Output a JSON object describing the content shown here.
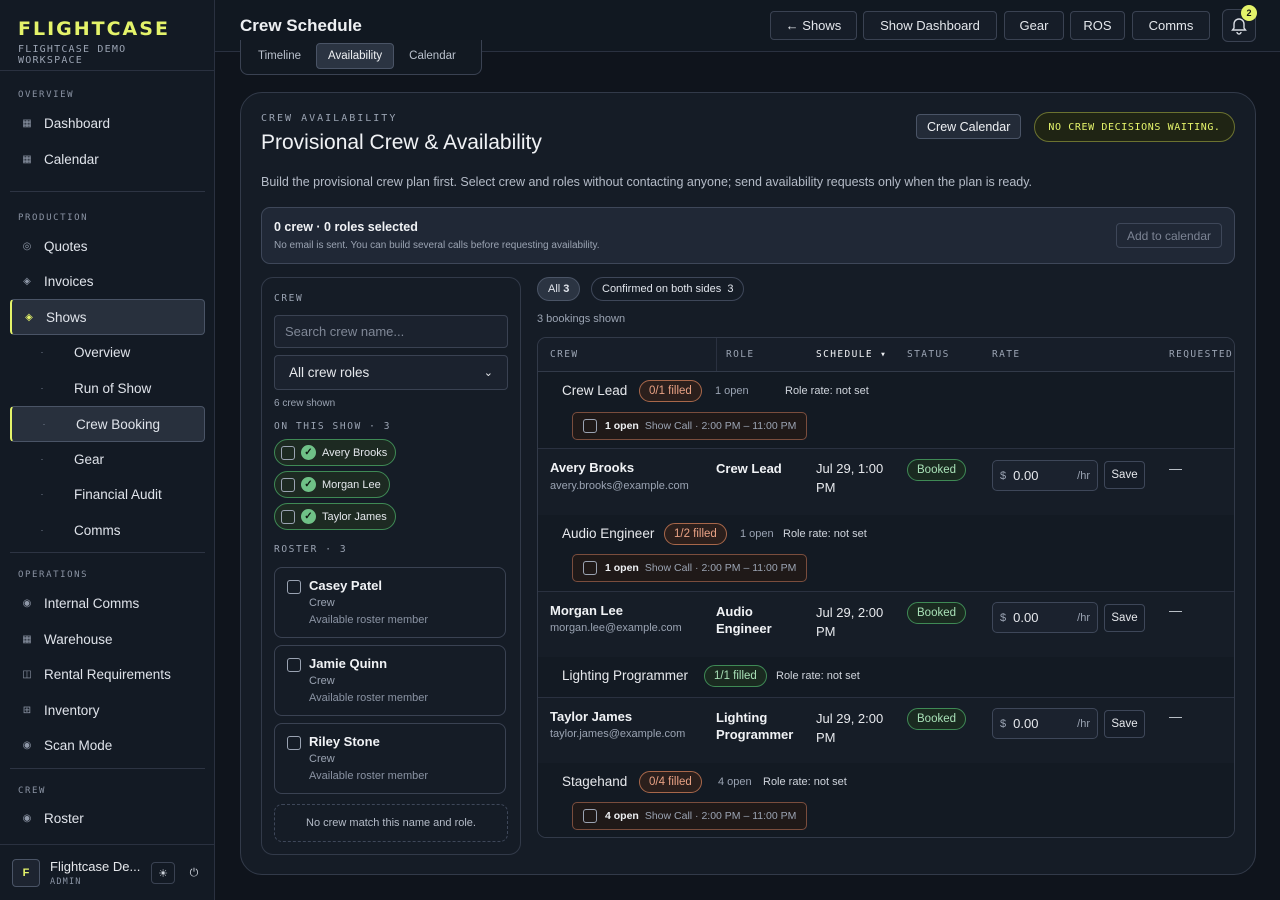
{
  "brand": {
    "title": "FLIGHTCASE",
    "subtitle": "FLIGHTCASE DEMO WORKSPACE"
  },
  "sidebar": {
    "sections": [
      {
        "label": "OVERVIEW"
      },
      {
        "label": "PRODUCTION"
      },
      {
        "label": "OPERATIONS"
      },
      {
        "label": "CREW"
      }
    ],
    "items": {
      "dashboard": "Dashboard",
      "calendar": "Calendar",
      "quotes": "Quotes",
      "invoices": "Invoices",
      "shows": "Shows",
      "overview": "Overview",
      "run_of_show": "Run of Show",
      "crew_booking": "Crew Booking",
      "gear": "Gear",
      "financial_audit": "Financial Audit",
      "comms": "Comms",
      "internal_comms": "Internal Comms",
      "warehouse": "Warehouse",
      "rental_requirements": "Rental Requirements",
      "inventory": "Inventory",
      "scan_mode": "Scan Mode",
      "roster": "Roster"
    },
    "user": {
      "initial": "F",
      "name": "Flightcase De...",
      "role": "ADMIN"
    }
  },
  "header": {
    "title": "Crew Schedule",
    "buttons": {
      "shows": "← Shows",
      "show_dashboard": "Show Dashboard",
      "gear": "Gear",
      "ros": "ROS",
      "comms": "Comms"
    },
    "notifications": "2"
  },
  "tabs": [
    "Timeline",
    "Availability",
    "Calendar"
  ],
  "card": {
    "eyebrow": "CREW AVAILABILITY",
    "title": "Provisional Crew & Availability",
    "calendar_button": "Crew Calendar",
    "status": "NO CREW DECISIONS WAITING.",
    "description": "Build the provisional crew plan first. Select crew and roles without contacting anyone; send availability requests only when the plan is ready."
  },
  "selection": {
    "title": "0 crew · 0 roles selected",
    "subtitle": "No email is sent. You can build several calls before requesting availability.",
    "add_button": "Add to calendar"
  },
  "crew_panel": {
    "label": "CREW",
    "search_placeholder": "Search crew name...",
    "role_filter": "All crew roles",
    "shown_count": "6 crew shown",
    "on_show_label": "ON THIS SHOW · 3",
    "on_show": [
      "Avery Brooks",
      "Morgan Lee",
      "Taylor James"
    ],
    "roster_label": "ROSTER · 3",
    "roster": [
      {
        "name": "Casey Patel",
        "role": "Crew",
        "status": "Available roster member"
      },
      {
        "name": "Jamie Quinn",
        "role": "Crew",
        "status": "Available roster member"
      },
      {
        "name": "Riley Stone",
        "role": "Crew",
        "status": "Available roster member"
      }
    ],
    "empty": "No crew match this name and role."
  },
  "filters": {
    "all": "All",
    "all_count": "3",
    "confirmed": "Confirmed on both sides",
    "confirmed_count": "3"
  },
  "bookings_count": "3 bookings shown",
  "table": {
    "headers": {
      "crew": "CREW",
      "role": "ROLE",
      "schedule": "SCHEDULE ▾",
      "status": "STATUS",
      "rate": "RATE",
      "requested": "REQUESTED"
    },
    "groups": {
      "crew_lead": {
        "name": "Crew Lead",
        "filled": "0/1 filled",
        "open": "1 open",
        "rate": "Role rate: not set",
        "open_box": "1 open",
        "call": "Show Call · 2:00 PM – 11:00 PM"
      },
      "audio": {
        "name": "Audio Engineer",
        "filled": "1/2 filled",
        "open": "1 open",
        "rate": "Role rate: not set",
        "open_box": "1 open",
        "call": "Show Call · 2:00 PM – 11:00 PM"
      },
      "lighting": {
        "name": "Lighting Programmer",
        "filled": "1/1 filled",
        "rate": "Role rate: not set"
      },
      "stagehand": {
        "name": "Stagehand",
        "filled": "0/4 filled",
        "open": "4 open",
        "rate": "Role rate: not set",
        "open_box": "4 open",
        "call": "Show Call · 2:00 PM – 11:00 PM"
      }
    },
    "rows": {
      "avery": {
        "name": "Avery Brooks",
        "email": "avery.brooks@example.com",
        "role": "Crew Lead",
        "schedule": "Jul 29, 1:00 PM",
        "status": "Booked",
        "currency": "$",
        "rate": "0.00",
        "unit": "/hr",
        "save": "Save",
        "requested": "—"
      },
      "morgan": {
        "name": "Morgan Lee",
        "email": "morgan.lee@example.com",
        "role": "Audio Engineer",
        "schedule": "Jul 29, 2:00 PM",
        "status": "Booked",
        "currency": "$",
        "rate": "0.00",
        "unit": "/hr",
        "save": "Save",
        "requested": "—"
      },
      "taylor": {
        "name": "Taylor James",
        "email": "taylor.james@example.com",
        "role": "Lighting Programmer",
        "schedule": "Jul 29, 2:00 PM",
        "status": "Booked",
        "currency": "$",
        "rate": "0.00",
        "unit": "/hr",
        "save": "Save",
        "requested": "—"
      }
    }
  },
  "colors": {
    "accent": "#e4f36a",
    "good": "#6fc187",
    "warn": "#e8a184"
  }
}
